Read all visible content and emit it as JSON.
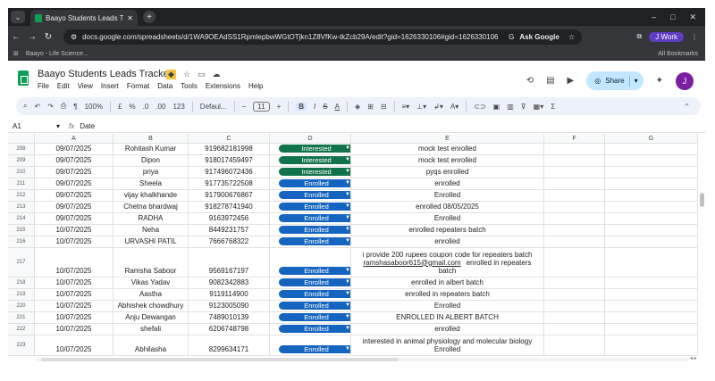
{
  "browser": {
    "tab_title": "Baayo Students Leads Tracker",
    "tab_close": "✕",
    "new_tab": "+",
    "url": "docs.google.com/spreadsheets/d/1WA9OEAdSS1RpmlepbwWGtOTjkn1Z8VfKw-tkZcb29A/edit?gid=1626330106#gid=1626330106",
    "ask_google": "Ask Google",
    "profile": "Work",
    "profile_initial": "J",
    "bookmark_item": "Baayo - Life Science...",
    "all_bookmarks": "All Bookmarks"
  },
  "sheets": {
    "title": "Baayo Students Leads Tracker",
    "menu": [
      "File",
      "Edit",
      "View",
      "Insert",
      "Format",
      "Data",
      "Tools",
      "Extensions",
      "Help"
    ],
    "share_label": "Share",
    "user_initial": "J",
    "toolbar": {
      "zoom": "100%",
      "currency": "£",
      "percent": "%",
      "dec_decrease": ".0",
      "dec_increase": ".00",
      "number_format": "123",
      "font": "Defaul...",
      "font_size": "11",
      "bold": "B",
      "italic": "I",
      "strike": "S",
      "text_color": "A"
    },
    "name_box": "A1",
    "formula_value": "Date"
  },
  "columns": [
    "A",
    "B",
    "C",
    "D",
    "E",
    "F",
    "G"
  ],
  "rows": [
    {
      "num": "208",
      "date": "09/07/2025",
      "name": "Rohitash Kumar",
      "phone": "919682181998",
      "status": "Interested",
      "note": "mock test enrolled"
    },
    {
      "num": "209",
      "date": "09/07/2025",
      "name": "Dipon",
      "phone": "918017459497",
      "status": "Interested",
      "note": "mock test enrolled"
    },
    {
      "num": "210",
      "date": "09/07/2025",
      "name": "priya",
      "phone": "917496072436",
      "status": "Interested",
      "note": "pyqs enrolled"
    },
    {
      "num": "211",
      "date": "09/07/2025",
      "name": "Sheela",
      "phone": "917735722508",
      "status": "Enrolled",
      "note": "enrolled"
    },
    {
      "num": "212",
      "date": "09/07/2025",
      "name": "vijay khalkhande",
      "phone": "917900676867",
      "status": "Enrolled",
      "note": "Enrolled"
    },
    {
      "num": "213",
      "date": "09/07/2025",
      "name": "Chetna bhardwaj",
      "phone": "918278741940",
      "status": "Enrolled",
      "note": "enrolled 08/05/2025"
    },
    {
      "num": "214",
      "date": "09/07/2025",
      "name": "RADHA",
      "phone": "9163972456",
      "status": "Enrolled",
      "note": "Enrolled"
    },
    {
      "num": "215",
      "date": "10/07/2025",
      "name": "Neha",
      "phone": "8449231757",
      "status": "Enrolled",
      "note": "enrolled repeaters batch"
    },
    {
      "num": "216",
      "date": "10/07/2025",
      "name": "URVASHI PATIL",
      "phone": "7666768322",
      "status": "Enrolled",
      "note": "enrolled"
    },
    {
      "num": "217",
      "date": "10/07/2025",
      "name": "Ramsha Saboor",
      "phone": "9569167197",
      "status": "Enrolled",
      "note_line1": "i provide 200 rupees coupon code for repeaters batch",
      "note_email": "ramshasaboor615@gmail.com",
      "note_line2": "enrolled in repeaters batch"
    },
    {
      "num": "218",
      "date": "10/07/2025",
      "name": "Vikas Yadav",
      "phone": "9082342883",
      "status": "Enrolled",
      "note": "enrolled in albert batch"
    },
    {
      "num": "219",
      "date": "10/07/2025",
      "name": "Aastha",
      "phone": "9119114900",
      "status": "Enrolled",
      "note": "enrolled in repeaters batch"
    },
    {
      "num": "220",
      "date": "10/07/2025",
      "name": "Abhishek chowdhury",
      "phone": "9123005090",
      "status": "Enrolled",
      "note": "Enrolled"
    },
    {
      "num": "221",
      "date": "10/07/2025",
      "name": "Anju Dewangan",
      "phone": "7489010139",
      "status": "Enrolled",
      "note": "ENROLLED IN ALBERT BATCH"
    },
    {
      "num": "222",
      "date": "10/07/2025",
      "name": "shefali",
      "phone": "6206748798",
      "status": "Enrolled",
      "note": "enrolled"
    },
    {
      "num": "223",
      "date": "10/07/2025",
      "name": "Abhilasha",
      "phone": "8299634171",
      "status": "Enrolled",
      "note_line1": "interested in animal physiology and molecular biology",
      "note_line2": "Enrolled"
    }
  ]
}
